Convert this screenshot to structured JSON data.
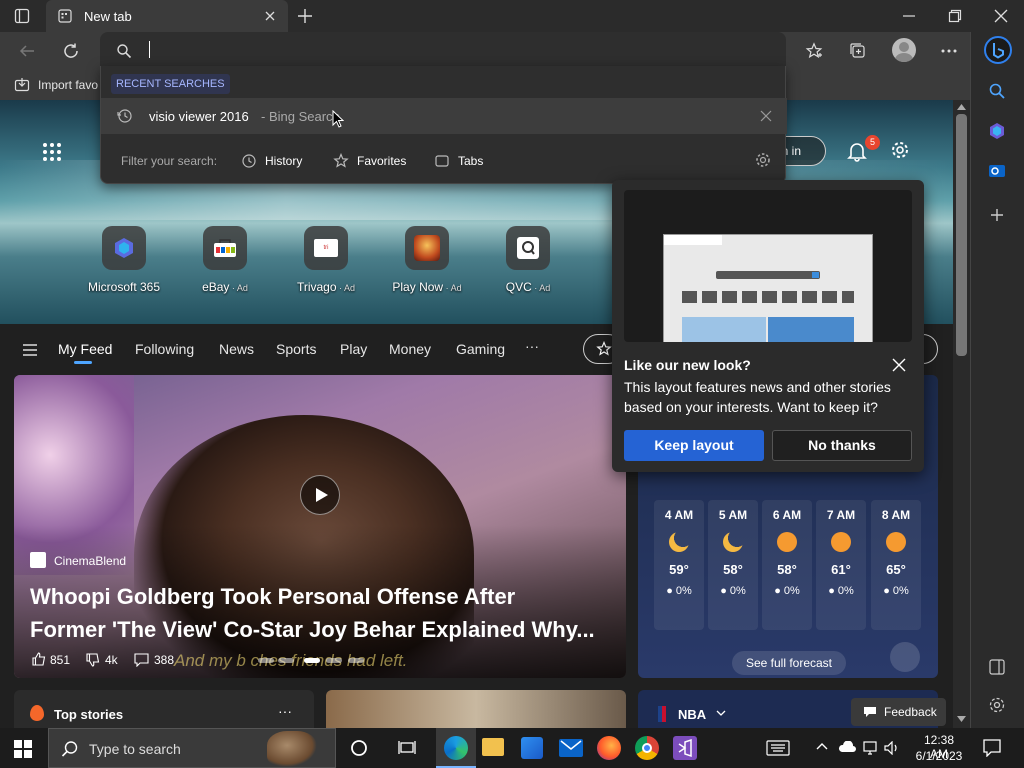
{
  "browser": {
    "tab_title": "New tab",
    "favorites_bar_item": "Import favo",
    "search_placeholder": ""
  },
  "search_dropdown": {
    "section_label": "RECENT SEARCHES",
    "recent": {
      "query": "visio viewer 2016",
      "suffix": " - Bing Search"
    },
    "filter_label": "Filter your search:",
    "filters": [
      "History",
      "Favorites",
      "Tabs"
    ]
  },
  "header": {
    "sign_in": "gn in",
    "notifications_count": "5"
  },
  "quick_links": [
    {
      "label": "Microsoft 365",
      "ad": ""
    },
    {
      "label": "eBay",
      "ad": " · Ad"
    },
    {
      "label": "Trivago",
      "ad": " · Ad"
    },
    {
      "label": "Play Now",
      "ad": " · Ad"
    },
    {
      "label": "QVC",
      "ad": " · Ad"
    }
  ],
  "feed_nav": [
    "My Feed",
    "Following",
    "News",
    "Sports",
    "Play",
    "Money",
    "Gaming",
    "···"
  ],
  "main_story": {
    "source": "CinemaBlend",
    "headline_line1": "Whoopi Goldberg Took Personal Offense After",
    "headline_line2": "Former 'The View' Co-Star Joy Behar Explained Why...",
    "likes": "851",
    "dislikes": "4k",
    "comments": "388",
    "caption": "And my b  ches  friends had left."
  },
  "weather": {
    "hours": [
      {
        "time": "4 AM",
        "temp": "59°",
        "precip": "0%",
        "icon": "moon"
      },
      {
        "time": "5 AM",
        "temp": "58°",
        "precip": "0%",
        "icon": "moon"
      },
      {
        "time": "6 AM",
        "temp": "58°",
        "precip": "0%",
        "icon": "sun"
      },
      {
        "time": "7 AM",
        "temp": "61°",
        "precip": "0%",
        "icon": "sun"
      },
      {
        "time": "8 AM",
        "temp": "65°",
        "precip": "0%",
        "icon": "sun"
      }
    ],
    "forecast_button": "See full forecast"
  },
  "bottom": {
    "top_stories": "Top stories",
    "nba": "NBA",
    "feedback": "Feedback"
  },
  "popup": {
    "title": "Like our new look?",
    "body": "This layout features news and other stories based on your interests. Want to keep it?",
    "keep": "Keep layout",
    "no": "No thanks"
  },
  "taskbar": {
    "search_placeholder": "Type to search",
    "time": "12:38 AM",
    "date": "6/1/2023"
  },
  "colors": {
    "accent": "#2563d4",
    "weather_moon": "#f5b942",
    "weather_sun": "#f59a30"
  }
}
